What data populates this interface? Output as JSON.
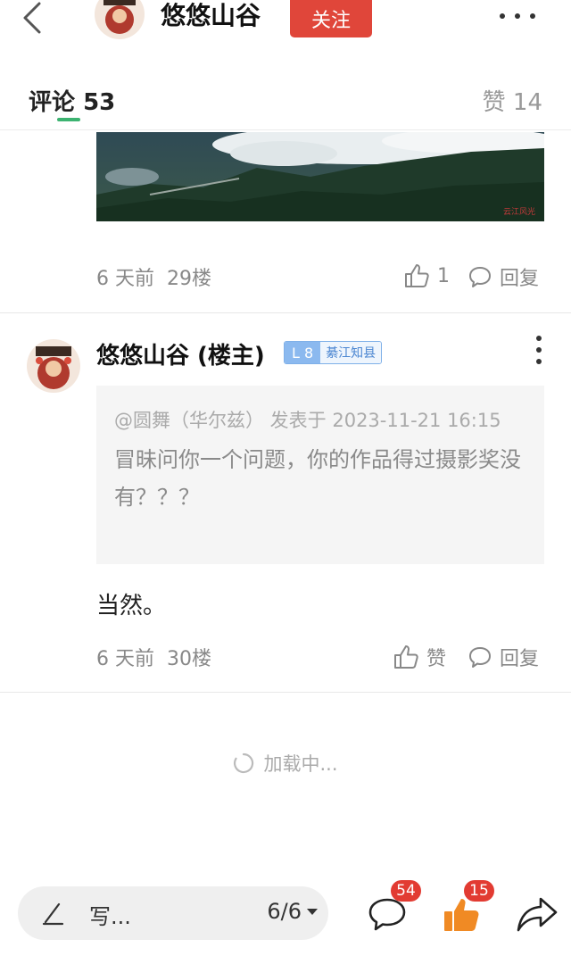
{
  "header": {
    "name": "悠悠山谷",
    "follow_label": "关注"
  },
  "tabs": {
    "comments_label": "评论",
    "comments_count": "53",
    "likes_label": "赞",
    "likes_count": "14"
  },
  "prev_post": {
    "time": "6 天前",
    "floor": "29楼",
    "like_count": "1",
    "reply_label": "回复"
  },
  "comment": {
    "author": "悠悠山谷 (楼主)",
    "level": "L 8",
    "rank_title": "綦江知县",
    "quote_meta": "@圆舞（华尔兹） 发表于 2023-11-21 16:15",
    "quote_text": "冒昧问你一个问题，你的作品得过摄影奖没有？？？",
    "text": "当然。",
    "time": "6 天前",
    "floor": "30楼",
    "like_label": "赞",
    "reply_label": "回复"
  },
  "loading_text": "加载中...",
  "bottom_bar": {
    "write_placeholder": "写...",
    "page_indicator": "6/6",
    "comment_count": "54",
    "like_count": "15"
  },
  "colors": {
    "accent_red": "#e0463a",
    "tab_underline": "#3cb371",
    "like_orange": "#f08a24"
  },
  "icons": [
    "back-chevron-icon",
    "more-icon",
    "thumb-up-icon",
    "comment-bubble-icon",
    "kebab-icon",
    "spinner-icon",
    "pencil-icon",
    "share-arrow-icon"
  ]
}
